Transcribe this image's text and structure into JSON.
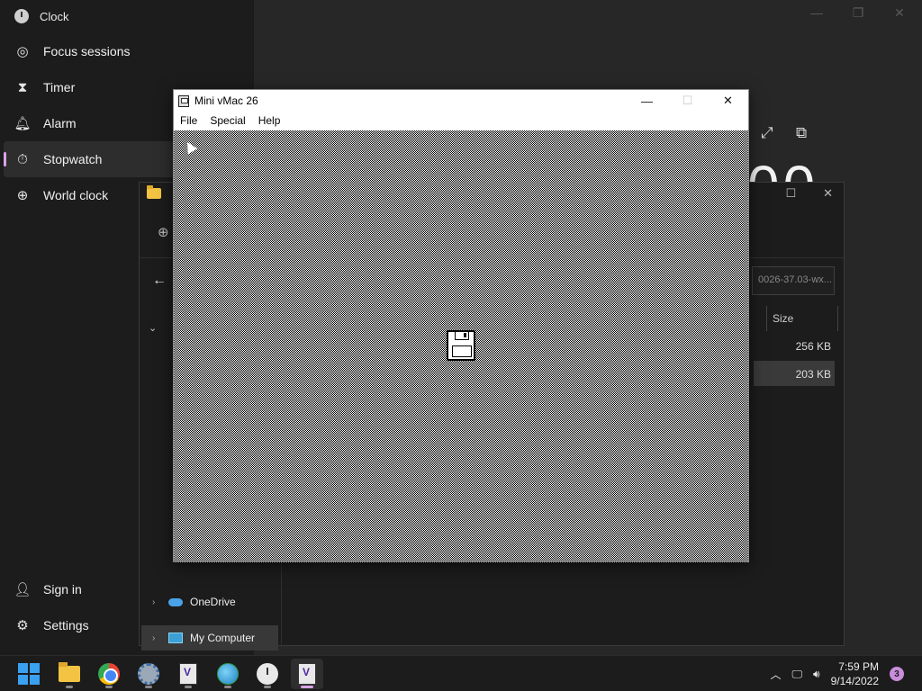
{
  "clock_app": {
    "title": "Clock",
    "nav_items": [
      {
        "label": "Focus sessions",
        "icon": "focus-icon",
        "selected": false
      },
      {
        "label": "Timer",
        "icon": "hourglass-icon",
        "selected": false
      },
      {
        "label": "Alarm",
        "icon": "bell-icon",
        "selected": false
      },
      {
        "label": "Stopwatch",
        "icon": "stopwatch-icon",
        "selected": true
      },
      {
        "label": "World clock",
        "icon": "globe-icon",
        "selected": false
      }
    ],
    "bottom_items": [
      {
        "label": "Sign in",
        "icon": "person-icon"
      },
      {
        "label": "Settings",
        "icon": "gear-icon"
      }
    ],
    "stopwatch_digits": "00",
    "accent_color": "#d9a3e6"
  },
  "explorer": {
    "search_placeholder": "0026-37.03-wx...",
    "column_size": "Size",
    "rows": [
      {
        "size": "256 KB",
        "selected": false
      },
      {
        "size": "203 KB",
        "selected": true
      }
    ],
    "nav_items": [
      {
        "label": "OneDrive",
        "icon": "onedrive-icon"
      },
      {
        "label": "My Computer",
        "icon": "computer-icon",
        "selected": true
      }
    ]
  },
  "vmac": {
    "title": "Mini vMac 26",
    "menu": [
      "File",
      "Special",
      "Help"
    ],
    "screen_icon": "floppy-disk-icon"
  },
  "taskbar": {
    "apps": [
      {
        "name": "start",
        "icon": "windows-start-icon"
      },
      {
        "name": "file-explorer",
        "icon": "folder-icon"
      },
      {
        "name": "chrome",
        "icon": "chrome-icon"
      },
      {
        "name": "settings",
        "icon": "settings-gear-icon"
      },
      {
        "name": "mini-vmac-1",
        "icon": "mini-vmac-icon"
      },
      {
        "name": "globe-app",
        "icon": "globe-icon"
      },
      {
        "name": "clock",
        "icon": "clock-icon"
      },
      {
        "name": "mini-vmac-2",
        "icon": "mini-vmac-icon",
        "active": true
      }
    ],
    "time": "7:59 PM",
    "date": "9/14/2022",
    "notification_count": "3"
  }
}
